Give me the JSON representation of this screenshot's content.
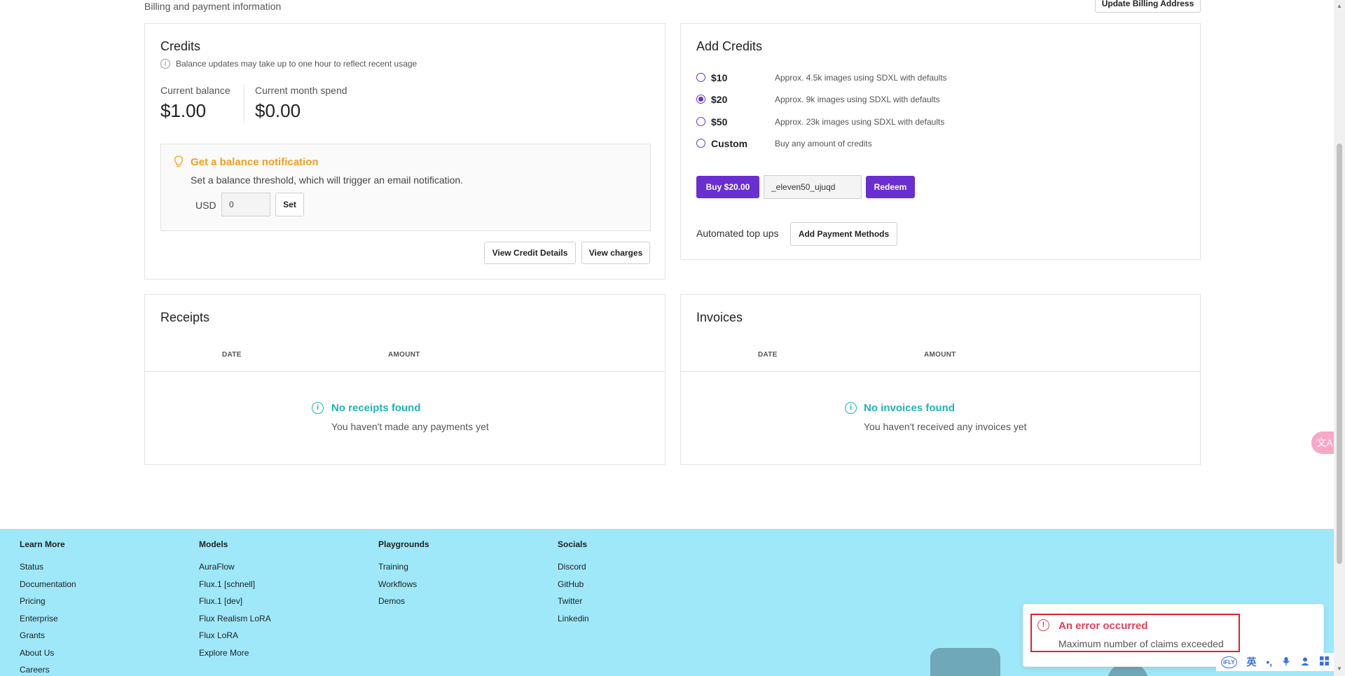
{
  "page": {
    "subtitle": "Billing and payment information",
    "update_billing_label": "Update Billing Address"
  },
  "credits": {
    "title": "Credits",
    "info_text": "Balance updates may take up to one hour to reflect recent usage",
    "current_balance_label": "Current balance",
    "current_balance_value": "$1.00",
    "month_spend_label": "Current month spend",
    "month_spend_value": "$0.00",
    "notification": {
      "title": "Get a balance notification",
      "description": "Set a balance threshold, which will trigger an email notification.",
      "currency_label": "USD",
      "threshold_value": "0",
      "set_label": "Set"
    },
    "view_credit_details_label": "View Credit Details",
    "view_charges_label": "View charges"
  },
  "add_credits": {
    "title": "Add Credits",
    "options": [
      {
        "amount": "$10",
        "description": "Approx. 4.5k images using SDXL with defaults",
        "selected": false
      },
      {
        "amount": "$20",
        "description": "Approx. 9k images using SDXL with defaults",
        "selected": true
      },
      {
        "amount": "$50",
        "description": "Approx. 23k images using SDXL with defaults",
        "selected": false
      },
      {
        "amount": "Custom",
        "description": "Buy any amount of credits",
        "selected": false
      }
    ],
    "buy_label": "Buy $20.00",
    "code_value": "_eleven50_ujuqd",
    "redeem_label": "Redeem",
    "automated_label": "Automated top ups",
    "add_payment_label": "Add Payment Methods"
  },
  "receipts": {
    "title": "Receipts",
    "columns": [
      "DATE",
      "AMOUNT"
    ],
    "empty_title": "No receipts found",
    "empty_desc": "You haven't made any payments yet"
  },
  "invoices": {
    "title": "Invoices",
    "columns": [
      "DATE",
      "AMOUNT"
    ],
    "empty_title": "No invoices found",
    "empty_desc": "You haven't received any invoices yet"
  },
  "footer": {
    "columns": [
      {
        "heading": "Learn More",
        "links": [
          "Status",
          "Documentation",
          "Pricing",
          "Enterprise",
          "Grants",
          "About Us",
          "Careers"
        ]
      },
      {
        "heading": "Models",
        "links": [
          "AuraFlow",
          "Flux.1 [schnell]",
          "Flux.1 [dev]",
          "Flux Realism LoRA",
          "Flux LoRA",
          "Explore More"
        ]
      },
      {
        "heading": "Playgrounds",
        "links": [
          "Training",
          "Workflows",
          "Demos"
        ]
      },
      {
        "heading": "Socials",
        "links": [
          "Discord",
          "GitHub",
          "Twitter",
          "Linkedin"
        ]
      }
    ]
  },
  "toast": {
    "title": "An error occurred",
    "message": "Maximum number of claims exceeded"
  },
  "ime": {
    "brand": "iFLY",
    "lang": "英",
    "punct": "•,"
  },
  "translate": {
    "glyph": "文A"
  },
  "colors": {
    "accent": "#6a2fd1",
    "warning": "#f0a020",
    "teal": "#20b4b4",
    "error": "#e0405a",
    "footer_bg": "#9ee8fa"
  }
}
